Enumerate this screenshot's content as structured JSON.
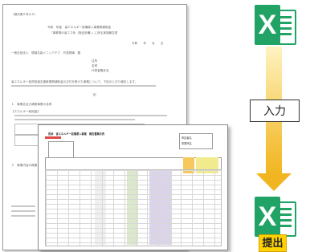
{
  "docA": {
    "header_tag": "（様式第６号の４）",
    "title_1": "令和　年度　省エネルギー設備導入事業費補助金",
    "title_2": "「事業場の省エネ化（指定設備）」に係る実施報告書",
    "date_line": "令和　　年　　月　　日",
    "addressee": "一般社団法人　環境共創イニシアチブ　代表理事　殿",
    "fields": [
      "住所",
      "名称",
      "代表者職氏名"
    ],
    "body_1": "省エネルギー投資促進支援事業費補助金の交付を受けた事業について、下記のとおり報告します。",
    "center_mark": "記",
    "item_1": "１　事業名及び補助事業の名称",
    "item_2": "【エネルギー使用量】",
    "item_3": "２　事業内容の概要"
  },
  "docB": {
    "title": "別添　省エネルギー設備導入事業　報告書集計表",
    "cell_a": "申請者名",
    "cell_b": "事業所名"
  },
  "labels": {
    "input": "入力",
    "submit": "提出",
    "excel_letter": "X"
  },
  "colors": {
    "excel_green": "#21a366",
    "arrow": "#f0b520",
    "submit_bg": "#ffd200"
  }
}
